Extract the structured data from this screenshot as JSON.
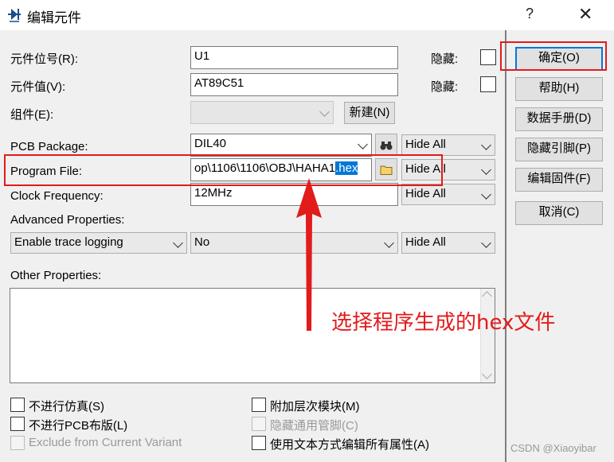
{
  "window": {
    "title": "编辑元件",
    "help_glyph": "?",
    "close_glyph": "✕"
  },
  "fields": {
    "ref_label": "元件位号(R):",
    "ref_value": "U1",
    "ref_hidden_label": "隐藏:",
    "val_label": "元件值(V):",
    "val_value": "AT89C51",
    "val_hidden_label": "隐藏:",
    "group_label": "组件(E):",
    "new_button": "新建(N)",
    "pcb_label": "PCB Package:",
    "pcb_value": "DIL40",
    "pcb_vis": "Hide All",
    "prog_label": "Program File:",
    "prog_value_pre": "op\\1106\\1106\\OBJ\\HAHA1",
    "prog_value_sel": ".hex",
    "prog_vis": "Hide All",
    "clock_label": "Clock Frequency:",
    "clock_value": "12MHz",
    "clock_vis": "Hide All",
    "adv_label": "Advanced Properties:",
    "adv_prop": "Enable trace logging",
    "adv_value": "No",
    "adv_vis": "Hide All",
    "other_label": "Other Properties:"
  },
  "checkboxes": {
    "no_sim": "不进行仿真(S)",
    "no_pcb": "不进行PCB布版(L)",
    "exclude": "Exclude from Current Variant",
    "attach": "附加层次模块(M)",
    "hide_pins": "隐藏通用管脚(C)",
    "edit_text": "使用文本方式编辑所有属性(A)"
  },
  "buttons": {
    "ok": "确定(O)",
    "help": "帮助(H)",
    "datasheet": "数据手册(D)",
    "hide_pins": "隐藏引脚(P)",
    "edit_firmware": "编辑固件(F)",
    "cancel": "取消(C)"
  },
  "annotation": "选择程序生成的hex文件",
  "watermark": "CSDN @Xiaoyibar",
  "colors": {
    "annotation_red": "#e21b1b",
    "selection_blue": "#0078d7"
  }
}
